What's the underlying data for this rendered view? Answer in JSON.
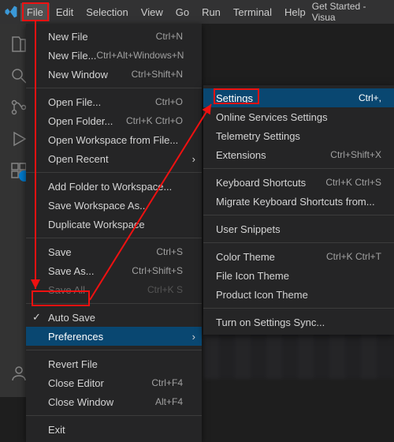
{
  "title_right": "Get Started - Visua",
  "menubar": [
    "File",
    "Edit",
    "Selection",
    "View",
    "Go",
    "Run",
    "Terminal",
    "Help"
  ],
  "file_menu": {
    "groups": [
      [
        {
          "label": "New File",
          "accel": "Ctrl+N"
        },
        {
          "label": "New File...",
          "accel": "Ctrl+Alt+Windows+N"
        },
        {
          "label": "New Window",
          "accel": "Ctrl+Shift+N"
        }
      ],
      [
        {
          "label": "Open File...",
          "accel": "Ctrl+O"
        },
        {
          "label": "Open Folder...",
          "accel": "Ctrl+K Ctrl+O"
        },
        {
          "label": "Open Workspace from File..."
        },
        {
          "label": "Open Recent",
          "submenu": true
        }
      ],
      [
        {
          "label": "Add Folder to Workspace..."
        },
        {
          "label": "Save Workspace As..."
        },
        {
          "label": "Duplicate Workspace"
        }
      ],
      [
        {
          "label": "Save",
          "accel": "Ctrl+S"
        },
        {
          "label": "Save As...",
          "accel": "Ctrl+Shift+S"
        },
        {
          "label": "Save All",
          "accel": "Ctrl+K S",
          "disabled": true
        }
      ],
      [
        {
          "label": "Auto Save",
          "checked": true
        },
        {
          "label": "Preferences",
          "submenu": true,
          "highlight": true
        }
      ],
      [
        {
          "label": "Revert File"
        },
        {
          "label": "Close Editor",
          "accel": "Ctrl+F4"
        },
        {
          "label": "Close Window",
          "accel": "Alt+F4"
        }
      ],
      [
        {
          "label": "Exit"
        }
      ]
    ]
  },
  "pref_submenu": {
    "groups": [
      [
        {
          "label": "Settings",
          "accel": "Ctrl+,",
          "highlight": true
        },
        {
          "label": "Online Services Settings"
        },
        {
          "label": "Telemetry Settings"
        },
        {
          "label": "Extensions",
          "accel": "Ctrl+Shift+X"
        }
      ],
      [
        {
          "label": "Keyboard Shortcuts",
          "accel": "Ctrl+K Ctrl+S"
        },
        {
          "label": "Migrate Keyboard Shortcuts from..."
        }
      ],
      [
        {
          "label": "User Snippets"
        }
      ],
      [
        {
          "label": "Color Theme",
          "accel": "Ctrl+K Ctrl+T"
        },
        {
          "label": "File Icon Theme"
        },
        {
          "label": "Product Icon Theme"
        }
      ],
      [
        {
          "label": "Turn on Settings Sync..."
        }
      ]
    ]
  }
}
